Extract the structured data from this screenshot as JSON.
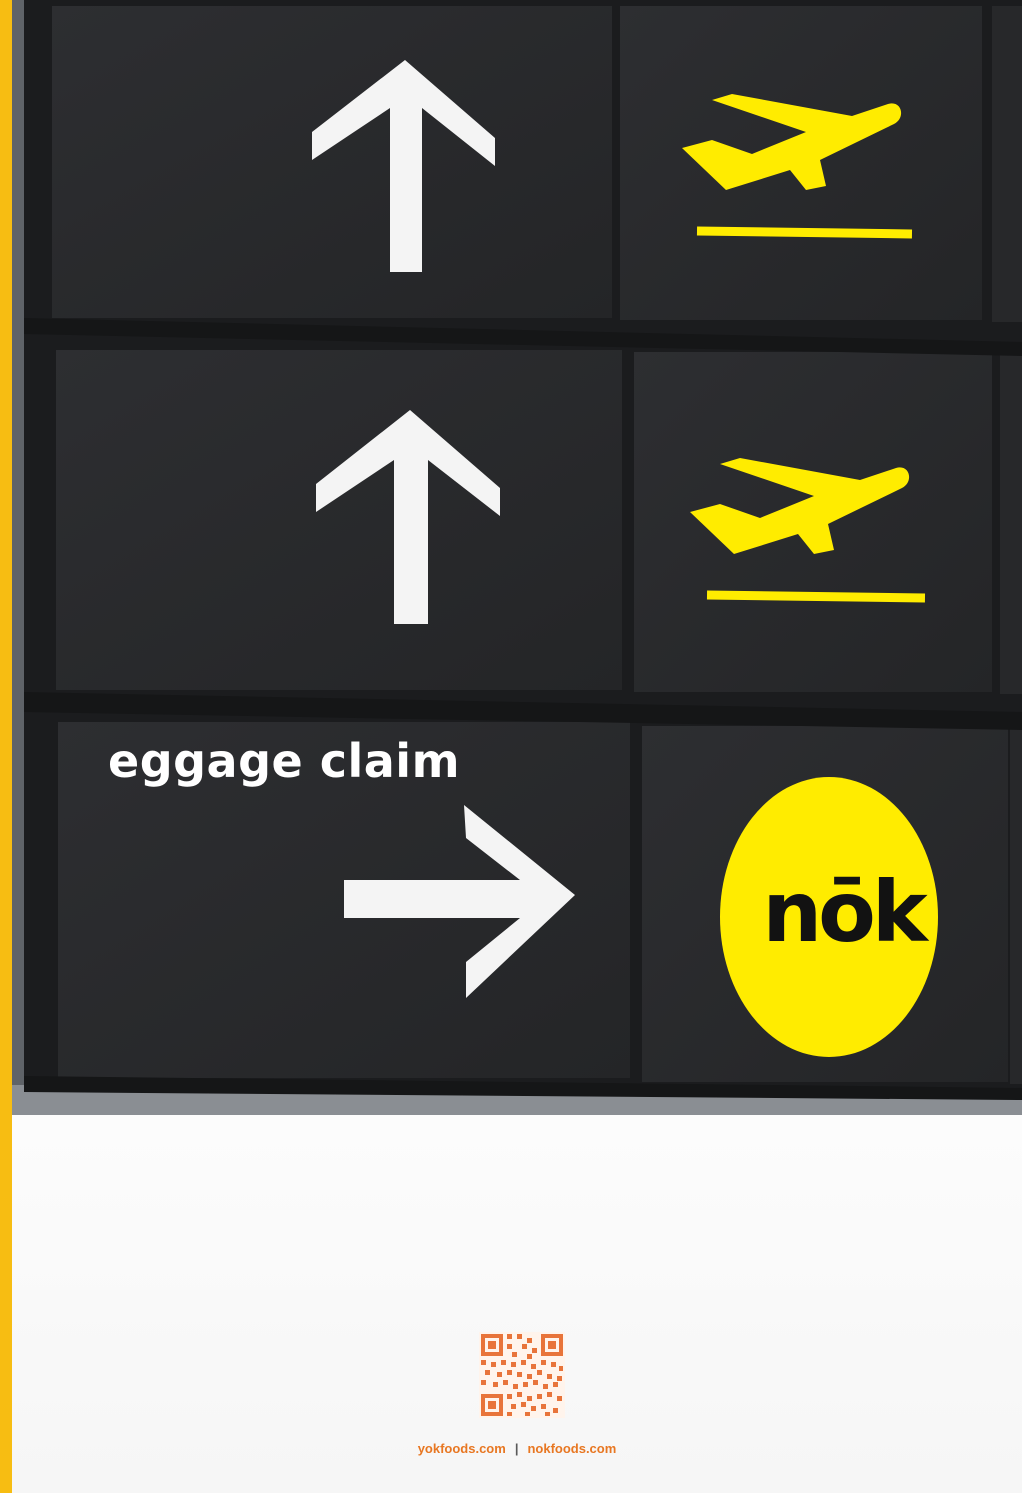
{
  "sign": {
    "caption": "eggage claim",
    "brand": "nōk"
  },
  "icons": {
    "row1_left": "arrow-up-icon",
    "row1_right": "departures-plane-icon",
    "row2_left": "arrow-up-icon",
    "row2_right": "departures-plane-icon",
    "row3_left": "arrow-right-icon",
    "row3_right": "nok-logo-badge"
  },
  "footer": {
    "links": [
      "yokfoods.com",
      "nokfoods.com"
    ],
    "separator": "|",
    "qr": "qr-code"
  },
  "colors": {
    "accent_bar": "#f7bd12",
    "sign_yellow": "#ffec00",
    "panel": "#2b2c2f",
    "arrow_white": "#f5f5f5",
    "link_orange": "#e87722"
  }
}
